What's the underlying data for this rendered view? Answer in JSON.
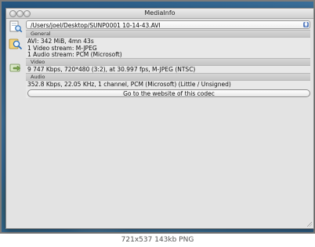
{
  "window": {
    "title": "MediaInfo"
  },
  "file": {
    "selected": "/Users/joel/Desktop/SUNP0001 10-14-43.AVI"
  },
  "sections": {
    "general": {
      "header": "General",
      "lines": [
        "AVI: 342 MiB, 4mn 43s",
        "1 Video stream: M-JPEG",
        "1 Audio stream: PCM (Microsoft)"
      ]
    },
    "video": {
      "header": "Video",
      "lines": [
        "9 747 Kbps, 720*480 (3:2), at 30.997 fps, M-JPEG (NTSC)"
      ]
    },
    "audio": {
      "header": "Audio",
      "lines": [
        "352.8 Kbps, 22.05 KHz, 1 channel, PCM (Microsoft) (Little / Unsigned)"
      ]
    }
  },
  "codec_button_label": "Go to the website of this codec",
  "image_caption": "721x537 143kb PNG",
  "icons": [
    "open-file-icon",
    "info-magnifier-icon",
    "export-icon"
  ]
}
